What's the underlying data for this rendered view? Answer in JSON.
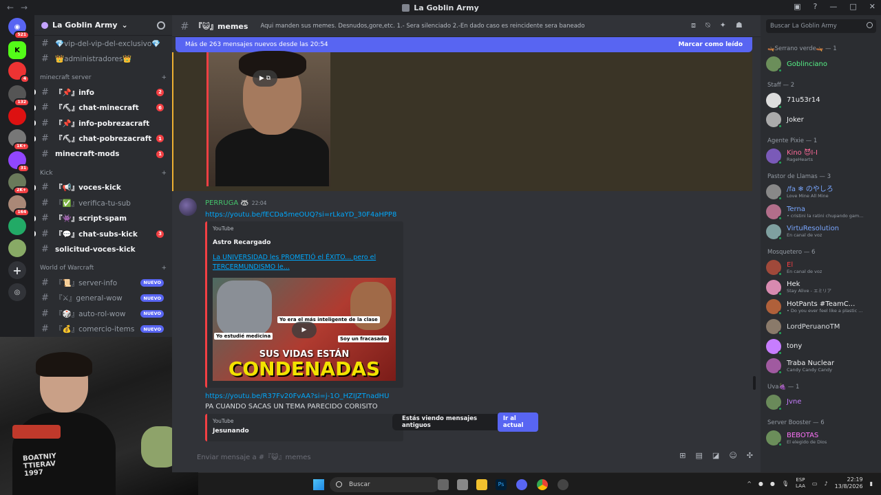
{
  "window": {
    "title": "La Goblin Army"
  },
  "rail": {
    "badges": [
      "521",
      "4",
      "132",
      "1K+",
      "31",
      "2K+",
      "164"
    ]
  },
  "server": {
    "name": "La Goblin Army"
  },
  "channels": {
    "top": [
      {
        "label": "💎vip-del-vip-del-exclusivo💎"
      },
      {
        "label": "👑administradores👑"
      }
    ],
    "cat1": "minecraft server",
    "mc": [
      {
        "label": "『📌』info",
        "count": "2"
      },
      {
        "label": "『⛏』chat-minecraft",
        "count": "6"
      },
      {
        "label": "『📌』info-pobrezacraft",
        "count": ""
      },
      {
        "label": "『⛏』chat-pobrezacraft",
        "count": "1"
      },
      {
        "label": "minecraft-mods",
        "count": "1"
      }
    ],
    "cat2": "Kick",
    "kick": [
      {
        "label": "『📢』voces-kick",
        "count": ""
      },
      {
        "label": "『✅』verifica-tu-sub",
        "count": ""
      },
      {
        "label": "『👾』script-spam",
        "count": ""
      },
      {
        "label": "『💬』chat-subs-kick",
        "count": "3"
      },
      {
        "label": "solicitud-voces-kick",
        "count": ""
      }
    ],
    "cat3": "World of Warcraft",
    "wow": [
      {
        "label": "『📜』server-info",
        "badge": "NUEVO"
      },
      {
        "label": "『⚔』general-wow",
        "badge": "NUEVO"
      },
      {
        "label": "『🎲』auto-rol-wow",
        "badge": "NUEVO"
      },
      {
        "label": "『💰』comercio-items",
        "badge": "NUEVO"
      }
    ]
  },
  "webcam": {
    "shirt_text": "BOATNIY\nTTIERAV\n1997"
  },
  "chat": {
    "channel": "『😺』memes",
    "topic": "Aqui manden sus memes. Desnudos,gore,etc. 1.- Sera silenciado 2.-En dado caso es reincidente sera baneado",
    "new_bar": {
      "text": "Más de 263 mensajes nuevos desde las 20:54",
      "action": "Marcar como leído"
    },
    "message": {
      "author": "PERRUGA 🦝",
      "time": "22:04",
      "link1": "https://youtu.be/fECDa5meOUQ?si=rLkaYD_30F4aHPP8",
      "embed1": {
        "provider": "YouTube",
        "author": "Astro Recargado",
        "title": "La UNIVERSIDAD les PROMETIÓ el ÉXITO... pero el TERCERMUNDISMO le...",
        "thumb_caption1": "Yo estudié medicina",
        "thumb_caption2": "Yo era el más inteligente de la clase",
        "thumb_caption3": "Soy un fracasado",
        "thumb_line1": "SUS VIDAS ESTÁN",
        "thumb_line2": "CONDENADAS"
      },
      "link2": "https://youtu.be/R37Fv20FvAA?si=j-1O_HZIJZTnadHU",
      "text2": "PA CUANDO SACAS UN TEMA PARECIDO CORISITO",
      "embed2": {
        "provider": "YouTube",
        "author": "Jesunando"
      }
    },
    "toast": {
      "text": "Estás viendo mensajes antiguos",
      "action": "Ir al actual"
    },
    "input_placeholder": "Enviar mensaje a #『😺』memes"
  },
  "members": {
    "search": "Buscar La Goblin Army",
    "groups": [
      {
        "title": "🛶Serrano verde🛶 — 1",
        "items": [
          {
            "name": "Goblinciano",
            "status": "",
            "color": "#57f287"
          }
        ]
      },
      {
        "title": "Staff — 2",
        "items": [
          {
            "name": "71u53r14",
            "status": "",
            "color": "#f2f3f5"
          },
          {
            "name": "Joker",
            "status": "",
            "color": "#f2f3f5"
          }
        ]
      },
      {
        "title": "Agente Pixie — 1",
        "items": [
          {
            "name": "Kino 😈I-I",
            "status": "RageHearts",
            "color": "#ff6b9a"
          }
        ]
      },
      {
        "title": "Pastor de Llamas — 3",
        "items": [
          {
            "name": "/fa ❄ のやしろ",
            "status": "Love Mine All Mine",
            "color": "#7aa7ff"
          },
          {
            "name": "Terna",
            "status": "• cristini la ratini chupando gam...",
            "color": "#7aa7ff"
          },
          {
            "name": "VirtuResolution",
            "status": "En canal de voz",
            "color": "#7aa7ff"
          }
        ]
      },
      {
        "title": "Mosquetero — 6",
        "items": [
          {
            "name": "El",
            "status": "En canal de voz",
            "color": "#f23f43"
          },
          {
            "name": "Hek",
            "status": "Stay Alive - エミリア",
            "color": "#f2f3f5"
          },
          {
            "name": "HotPants #TeamC...",
            "status": "• Do you ever feel like a plastic ...",
            "color": "#f2f3f5"
          },
          {
            "name": "LordPeruanoTM",
            "status": "",
            "color": "#dbdee1"
          },
          {
            "name": "tony",
            "status": "",
            "color": "#f2f3f5"
          },
          {
            "name": "Traba Nuclear",
            "status": "Candy Candy Candy",
            "color": "#f2f3f5"
          }
        ]
      },
      {
        "title": "Uva🍇 — 1",
        "items": [
          {
            "name": "Jvne",
            "status": "",
            "color": "#c77dff"
          }
        ]
      },
      {
        "title": "Server Booster — 6",
        "items": [
          {
            "name": "BEBOTAS",
            "status": "El elegido de Dios",
            "color": "#ff73fa"
          }
        ]
      }
    ]
  },
  "taskbar": {
    "search": "Buscar",
    "lang1": "ESP",
    "lang2": "LAA",
    "time": "22:19",
    "date": "13/8/2026"
  },
  "colors": {
    "accent": "#5865f2",
    "unread": "#f23f43",
    "online": "#23a55a",
    "link": "#00a8fc"
  }
}
